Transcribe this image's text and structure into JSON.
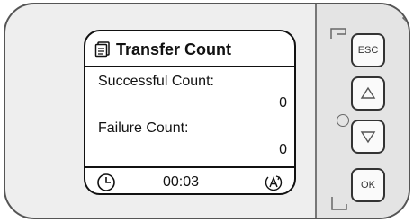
{
  "screen": {
    "title": "Transfer Count",
    "successful_label": "Successful Count:",
    "successful_value": "0",
    "failure_label": "Failure Count:",
    "failure_value": "0",
    "time": "00:03"
  },
  "buttons": {
    "esc": "ESC",
    "ok": "OK"
  },
  "icons": {
    "title": "documents-icon",
    "clock": "clock-icon",
    "auto": "auto-cycle-icon",
    "up": "up-arrow-icon",
    "down": "down-arrow-icon"
  }
}
